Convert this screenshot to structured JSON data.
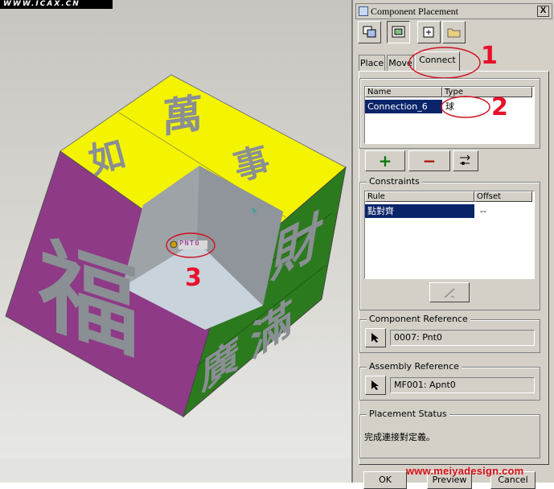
{
  "watermark_top": "WWW.ICAX.CN",
  "watermark_bottom": "www.meiyadesign.com",
  "viewport": {
    "cube_glyphs": {
      "top_1": "萬",
      "top_2": "如",
      "top_3": "事",
      "left": "福",
      "right_1": "財",
      "right_2": "滿",
      "right_3": "廣"
    },
    "datum_label": "PNT0",
    "annotation_3": "3"
  },
  "dialog": {
    "title": "Component Placement",
    "close_label": "X",
    "tabs": [
      "Place",
      "Move",
      "Connect"
    ],
    "annotation_1": "1",
    "annotation_2": "2",
    "connections": {
      "headers": [
        "Name",
        "Type"
      ],
      "rows": [
        {
          "name": "Connection_6",
          "type": "球"
        }
      ]
    },
    "add_label": "+",
    "remove_label": "−",
    "constraints": {
      "title": "Constraints",
      "headers": [
        "Rule",
        "Offset"
      ],
      "rows": [
        {
          "rule": "點對齊",
          "offset": "--"
        }
      ]
    },
    "component_reference": {
      "title": "Component Reference",
      "value": "0007: Pnt0"
    },
    "assembly_reference": {
      "title": "Assembly Reference",
      "value": "MF001: Apnt0"
    },
    "placement_status": {
      "title": "Placement Status",
      "text": "完成連接對定義。"
    },
    "buttons": {
      "ok": "OK",
      "preview": "Preview",
      "cancel": "Cancel"
    }
  },
  "colors": {
    "cube_top": "#f4f400",
    "cube_left": "#8e3a86",
    "cube_right": "#2c7a1e",
    "glyph_gray": "#8a8f94",
    "selection": "#0a246a",
    "annotation_red": "#e8102a"
  }
}
